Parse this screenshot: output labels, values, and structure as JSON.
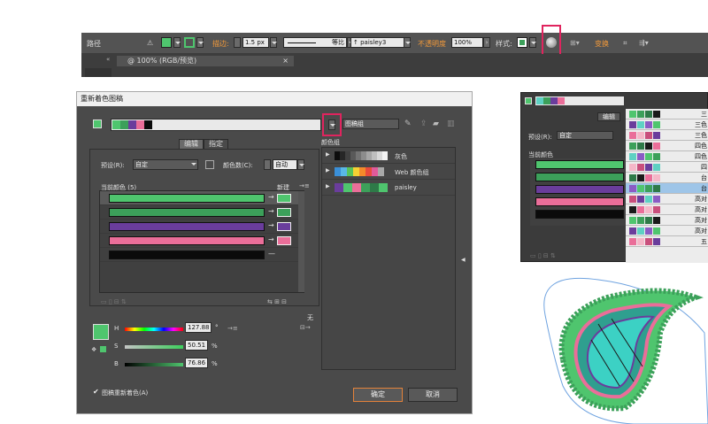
{
  "control_bar": {
    "label_path": "路径",
    "stroke_label": "描边:",
    "stroke_value": "1.5 px",
    "profile_label": "等比",
    "brush_label": "paisley3",
    "opacity_label": "不透明度",
    "opacity_value": "100%",
    "style_label": "样式:",
    "transform_label": "变换"
  },
  "tab": {
    "title": "@ 100% (RGB/预览)",
    "close": "×",
    "arrows": "«"
  },
  "dialog": {
    "title": "重新着色图稿",
    "group_name": "图稿组",
    "tabs": [
      "编辑",
      "指定"
    ],
    "preset_label": "预设(R):",
    "preset_value": "自定",
    "color_count_label": "颜色数(C):",
    "color_count_value": "自动",
    "current_colors_label": "当前颜色 (5)",
    "new_label": "新建",
    "current_colors": [
      "#4fc56e",
      "#3ca05a",
      "#6a3d9c",
      "#ea6e99",
      "#0b0b0b"
    ],
    "new_colors": [
      "#4fc56e",
      "#3ca05a",
      "#6a3d9c",
      "#ea6e99"
    ],
    "none_label": "无",
    "h_label": "H",
    "h_value": "127.88",
    "h_unit": "°",
    "s_label": "S",
    "s_value": "50.51",
    "s_unit": "%",
    "b_label": "B",
    "b_value": "76.86",
    "b_unit": "%",
    "recolor_checkbox_label": "图稿重新着色(A)",
    "ok_label": "确定",
    "cancel_label": "取消",
    "color_groups_label": "颜色组",
    "groups": [
      {
        "name": "灰色",
        "colors": [
          "#0d0d0d",
          "#262626",
          "#404040",
          "#595959",
          "#737373",
          "#8c8c8c",
          "#a6a6a6",
          "#bfbfbf",
          "#d9d9d9",
          "#f2f2f2"
        ]
      },
      {
        "name": "Web 颜色组",
        "colors": [
          "#3a8fd8",
          "#59b8e6",
          "#57c25b",
          "#f5d033",
          "#f38a2a",
          "#e74b3c",
          "#e05a9a",
          "#a8a8a8"
        ]
      },
      {
        "name": "paisley",
        "colors": [
          "#6a3d9c",
          "#4fc56e",
          "#ea6e99",
          "#3ca05a",
          "#2e7a48",
          "#4fc56e"
        ]
      }
    ]
  },
  "right_panel": {
    "tab_edit": "编辑",
    "preset_label": "预设(R):",
    "preset_value": "自定",
    "current_colors_label": "当前颜色",
    "list_labels": [
      "三",
      "三色",
      "三色",
      "四色",
      "四色",
      "四",
      "台",
      "台",
      "高对",
      "高对",
      "高对",
      "高对",
      "五"
    ]
  }
}
